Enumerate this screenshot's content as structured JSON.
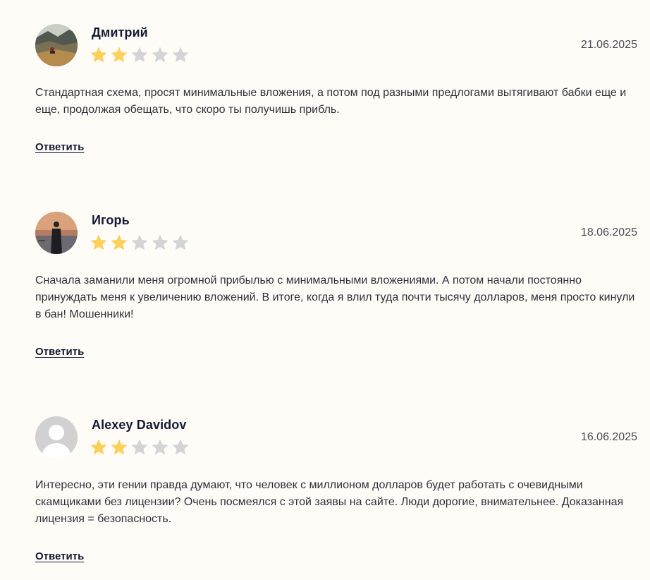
{
  "reviews": [
    {
      "author": "Дмитрий",
      "avatar": "landscape-photo-avatar",
      "rating": 2,
      "max_rating": 5,
      "date": "21.06.2025",
      "text": "Стандартная схема, просят минимальные вложения, а потом под разными предлогами вытягивают бабки еще и еще, продолжая обещать, что скоро ты получишь прибль.",
      "reply_label": "Ответить"
    },
    {
      "author": "Игорь",
      "avatar": "sunset-person-photo-avatar",
      "rating": 2,
      "max_rating": 5,
      "date": "18.06.2025",
      "text": "Сначала заманили меня огромной прибылью с минимальными вложениями. А потом начали постоянно принуждать меня к увеличению вложений. В итоге, когда я влил туда почти тысячу долларов, меня просто кинули в бан! Мошенники!",
      "reply_label": "Ответить"
    },
    {
      "author": "Alexey Davidov",
      "avatar": "default-user-avatar",
      "rating": 2,
      "max_rating": 5,
      "date": "16.06.2025",
      "text": "Интересно, эти гении правда думают, что человек с миллионом долларов будет работать с очевидными скамщиками без лицензии? Очень посмеялся с этой заявы на сайте. Люди дорогие, внимательнее. Доказанная лицензия = безопасность.",
      "reply_label": "Ответить"
    }
  ],
  "colors": {
    "star_filled": "#fdd05c",
    "star_empty": "#d4d4d6",
    "background": "#fffcf8"
  }
}
